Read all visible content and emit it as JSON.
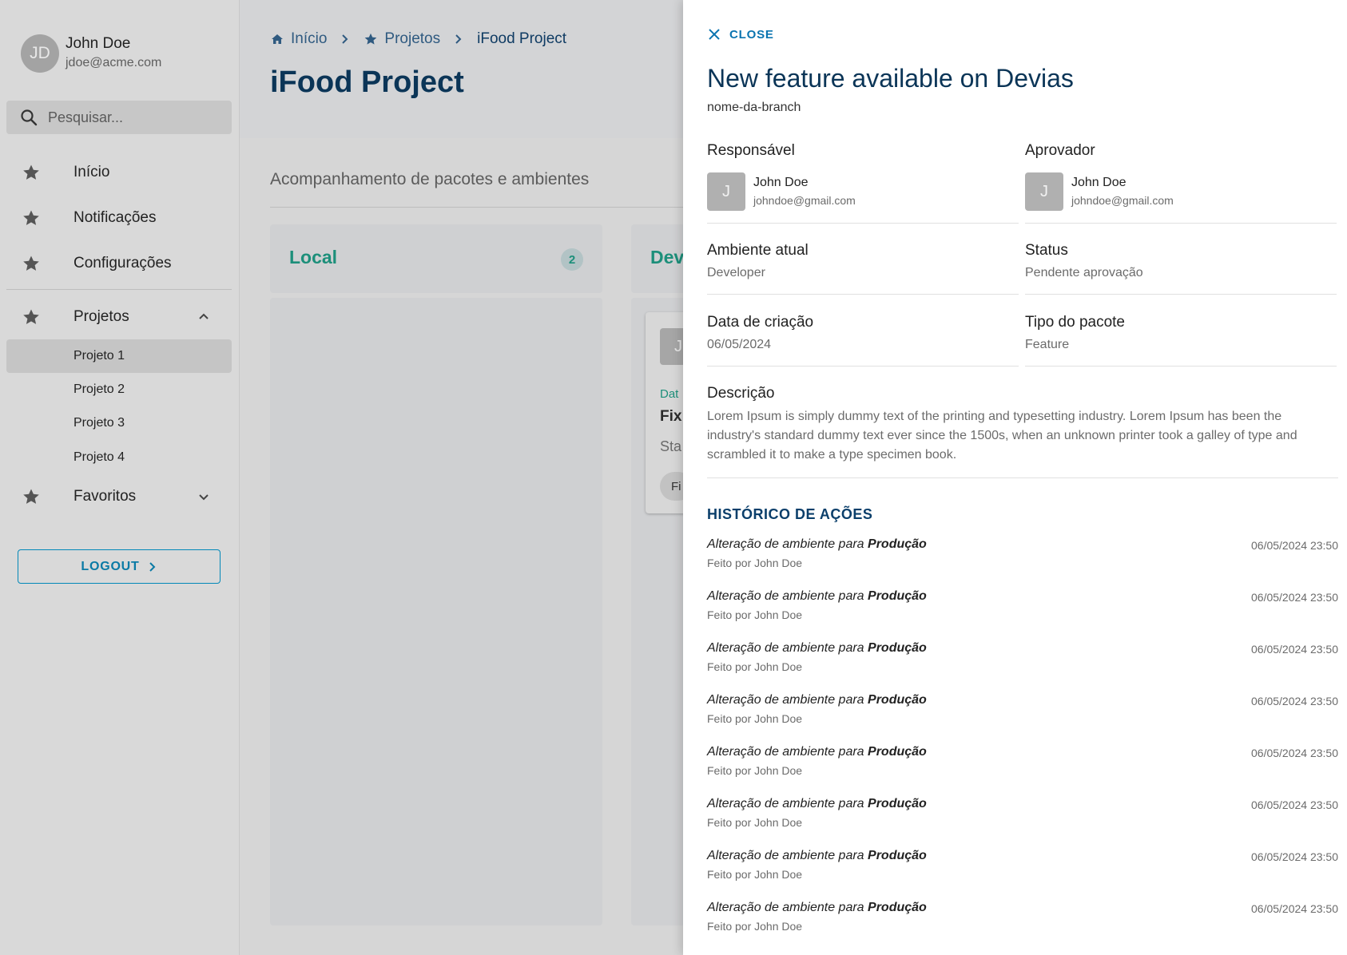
{
  "sidebar": {
    "user": {
      "initials": "JD",
      "name": "John Doe",
      "email": "jdoe@acme.com"
    },
    "search": {
      "placeholder": "Pesquisar..."
    },
    "items": [
      {
        "label": "Início",
        "icon": "star-icon"
      },
      {
        "label": "Notificações",
        "icon": "star-icon"
      },
      {
        "label": "Configurações",
        "icon": "star-icon"
      }
    ],
    "projects": {
      "label": "Projetos",
      "expanded": true,
      "children": [
        "Projeto 1",
        "Projeto 2",
        "Projeto 3",
        "Projeto 4"
      ],
      "active_index": 0
    },
    "favorites": {
      "label": "Favoritos",
      "expanded": false
    },
    "logout_label": "LOGOUT"
  },
  "header": {
    "breadcrumb": [
      "Início",
      "Projetos",
      "iFood Project"
    ],
    "title": "iFood Project"
  },
  "board": {
    "subtitle": "Acompanhamento de pacotes e ambientes",
    "columns": [
      {
        "title": "Local",
        "count": "2"
      },
      {
        "title": "Dev"
      }
    ],
    "card": {
      "avatar": "J",
      "date_label": "Dat",
      "title": "Fix",
      "status": "Sta",
      "chip": "Fi"
    }
  },
  "drawer": {
    "close_label": "CLOSE",
    "title": "New feature available on Devias",
    "branch": "nome-da-branch",
    "responsavel": {
      "label": "Responsável",
      "initial": "J",
      "name": "John Doe",
      "email": "johndoe@gmail.com"
    },
    "aprovador": {
      "label": "Aprovador",
      "initial": "J",
      "name": "John Doe",
      "email": "johndoe@gmail.com"
    },
    "ambiente": {
      "label": "Ambiente atual",
      "value": "Developer"
    },
    "status": {
      "label": "Status",
      "value": "Pendente aprovação"
    },
    "data_criacao": {
      "label": "Data de criação",
      "value": "06/05/2024"
    },
    "tipo_pacote": {
      "label": "Tipo do pacote",
      "value": "Feature"
    },
    "descricao": {
      "label": "Descrição",
      "text": "Lorem Ipsum is simply dummy text of the printing and typesetting industry. Lorem Ipsum has been the industry's standard dummy text ever since the 1500s, when an unknown printer took a galley of type and scrambled it to make a type specimen book."
    },
    "history_title": "HISTÓRICO DE AÇÕES",
    "history": [
      {
        "action": "Alteração de ambiente para",
        "target": "Produção",
        "by": "Feito por John Doe",
        "time": "06/05/2024 23:50"
      },
      {
        "action": "Alteração de ambiente para",
        "target": "Produção",
        "by": "Feito por John Doe",
        "time": "06/05/2024 23:50"
      },
      {
        "action": "Alteração de ambiente para",
        "target": "Produção",
        "by": "Feito por John Doe",
        "time": "06/05/2024 23:50"
      },
      {
        "action": "Alteração de ambiente para",
        "target": "Produção",
        "by": "Feito por John Doe",
        "time": "06/05/2024 23:50"
      },
      {
        "action": "Alteração de ambiente para",
        "target": "Produção",
        "by": "Feito por John Doe",
        "time": "06/05/2024 23:50"
      },
      {
        "action": "Alteração de ambiente para",
        "target": "Produção",
        "by": "Feito por John Doe",
        "time": "06/05/2024 23:50"
      },
      {
        "action": "Alteração de ambiente para",
        "target": "Produção",
        "by": "Feito por John Doe",
        "time": "06/05/2024 23:50"
      },
      {
        "action": "Alteração de ambiente para",
        "target": "Produção",
        "by": "Feito por John Doe",
        "time": "06/05/2024 23:50"
      }
    ]
  },
  "colors": {
    "primary": "#0b3557",
    "accent": "#1c8f7a",
    "link": "#0a74b0"
  }
}
